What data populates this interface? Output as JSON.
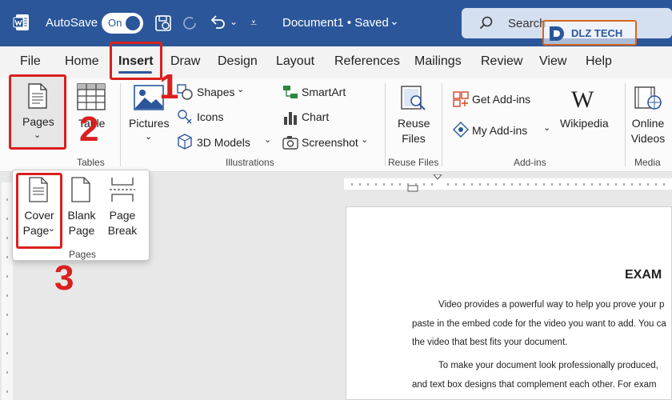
{
  "titlebar": {
    "autosave_label": "AutoSave",
    "toggle_label": "On",
    "doc_title": "Document1 • Saved",
    "search_placeholder": "Search",
    "logo_text": "DLZ TECH"
  },
  "menu": {
    "tabs": [
      "File",
      "Home",
      "Insert",
      "Draw",
      "Design",
      "Layout",
      "References",
      "Mailings",
      "Review",
      "View",
      "Help"
    ],
    "active": "Insert"
  },
  "ribbon": {
    "pages_btn": "Pages",
    "table_btn": "Table",
    "tables_group": "Tables",
    "pictures_btn": "Pictures",
    "shapes": "Shapes",
    "icons": "Icons",
    "models": "3D Models",
    "smartart": "SmartArt",
    "chart": "Chart",
    "screenshot": "Screenshot",
    "illustrations_group": "Illustrations",
    "reuse_line1": "Reuse",
    "reuse_line2": "Files",
    "reuse_group": "Reuse Files",
    "get_addins": "Get Add-ins",
    "my_addins": "My Add-ins",
    "wikipedia": "Wikipedia",
    "addins_group": "Add-ins",
    "online_line1": "Online",
    "online_line2": "Videos",
    "media_group": "Media"
  },
  "pages_popup": {
    "cover_line1": "Cover",
    "cover_line2": "Page",
    "blank_line1": "Blank",
    "blank_line2": "Page",
    "break_line1": "Page",
    "break_line2": "Break",
    "group": "Pages"
  },
  "annotations": [
    "1",
    "2",
    "3"
  ],
  "document": {
    "heading": "EXAM",
    "lines": [
      "Video provides a powerful way to help you prove your p",
      "paste in the embed code for the video you want to add. You ca",
      "the video that best fits your document.",
      "To make your document look professionally produced,",
      "and text box designs that complement each other. For exam"
    ]
  },
  "colors": {
    "accent": "#2b579a",
    "annotation_red": "#d9201f",
    "logo_orange": "#d9651c"
  }
}
